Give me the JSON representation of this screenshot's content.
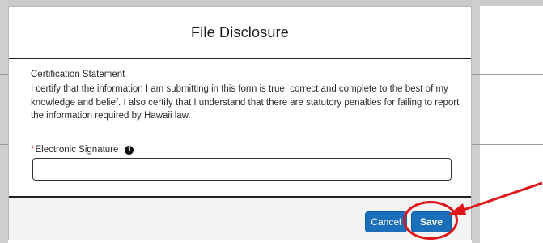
{
  "modal": {
    "title": "File Disclosure",
    "certification_heading": "Certification Statement",
    "certification_text": "I certify that the information I am submitting in this form is true, correct and complete to the best of my knowledge and belief. I also certify that I understand that there are statutory penalties for failing to report the information required by Hawaii law.",
    "signature_field": {
      "required_marker": "*",
      "label": "Electronic Signature",
      "value": "",
      "placeholder": ""
    },
    "buttons": {
      "cancel": "Cancel",
      "save": "Save"
    }
  },
  "colors": {
    "button": "#1b6fb8",
    "required": "#c23934",
    "annotation": "#e0141b"
  },
  "icons": {
    "info": "info-icon",
    "annotation_arrow": "arrow-icon"
  }
}
